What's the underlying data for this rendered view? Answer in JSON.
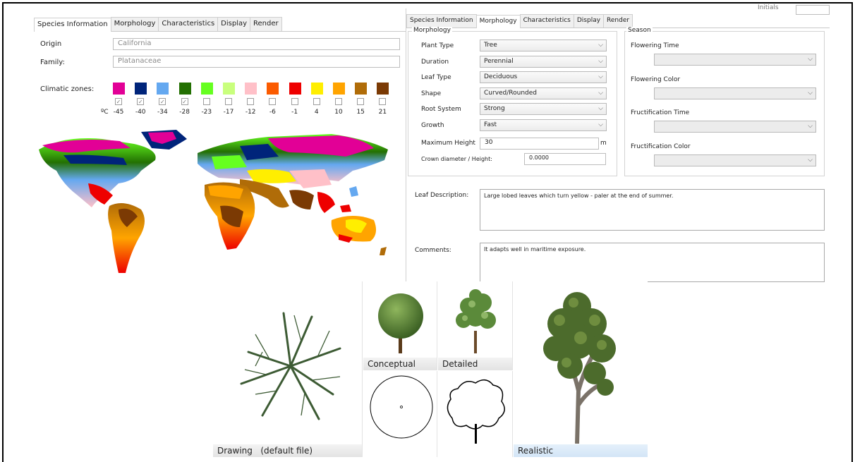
{
  "left_panel": {
    "tabs": [
      "Species Information",
      "Morphology",
      "Characteristics",
      "Display",
      "Render"
    ],
    "active_tab": 0,
    "origin_label": "Origin",
    "origin_value": "California",
    "family_label": "Family:",
    "family_value": "Platanaceae",
    "climatic_label": "Climatic zones:",
    "degree_label": "ºC",
    "zones": [
      {
        "color": "#e20096",
        "temp": "-45",
        "checked": true
      },
      {
        "color": "#00247a",
        "temp": "-40",
        "checked": true
      },
      {
        "color": "#64a8f0",
        "temp": "-34",
        "checked": true
      },
      {
        "color": "#237002",
        "temp": "-28",
        "checked": true
      },
      {
        "color": "#66ff20",
        "temp": "-23",
        "checked": false
      },
      {
        "color": "#c9ff7d",
        "temp": "-17",
        "checked": false
      },
      {
        "color": "#ffc0c8",
        "temp": "-12",
        "checked": false
      },
      {
        "color": "#fb5b00",
        "temp": "-6",
        "checked": false
      },
      {
        "color": "#ee0000",
        "temp": "-1",
        "checked": false
      },
      {
        "color": "#ffee00",
        "temp": "4",
        "checked": false
      },
      {
        "color": "#ffa400",
        "temp": "10",
        "checked": false
      },
      {
        "color": "#b06c08",
        "temp": "15",
        "checked": false
      },
      {
        "color": "#7b3a04",
        "temp": "21",
        "checked": false
      }
    ]
  },
  "right_panel": {
    "tabs": [
      "Species Information",
      "Morphology",
      "Characteristics",
      "Display",
      "Render"
    ],
    "active_tab": 1,
    "header_fragment": "Initials",
    "morphology_title": "Morphology",
    "rows": [
      {
        "label": "Plant Type",
        "value": "Tree"
      },
      {
        "label": "Duration",
        "value": "Perennial"
      },
      {
        "label": "Leaf Type",
        "value": "Deciduous"
      },
      {
        "label": "Shape",
        "value": "Curved/Rounded"
      },
      {
        "label": "Root System",
        "value": "Strong"
      },
      {
        "label": "Growth",
        "value": "Fast"
      }
    ],
    "max_height_label": "Maximum Height",
    "max_height_value": "30",
    "max_height_unit": "m",
    "crown_label": "Crown diameter / Height:",
    "crown_value": "0.0000",
    "season_title": "Season",
    "season_rows": [
      "Flowering Time",
      "Flowering Color",
      "Fructification Time",
      "Fructification Color"
    ],
    "leaf_desc_label": "Leaf Description:",
    "leaf_desc_value": "Large lobed leaves which turn yellow - paler at the end of summer.",
    "comments_label": "Comments:",
    "comments_value": "It adapts well in maritime exposure."
  },
  "display_panel": {
    "drawing_label": "Drawing   (default file)",
    "conceptual_label": "Conceptual",
    "detailed_label": "Detailed",
    "realistic_label": "Realistic"
  },
  "colors": {
    "tree_branch": "#3d5b34",
    "tree_green": "#5b8a3a"
  }
}
